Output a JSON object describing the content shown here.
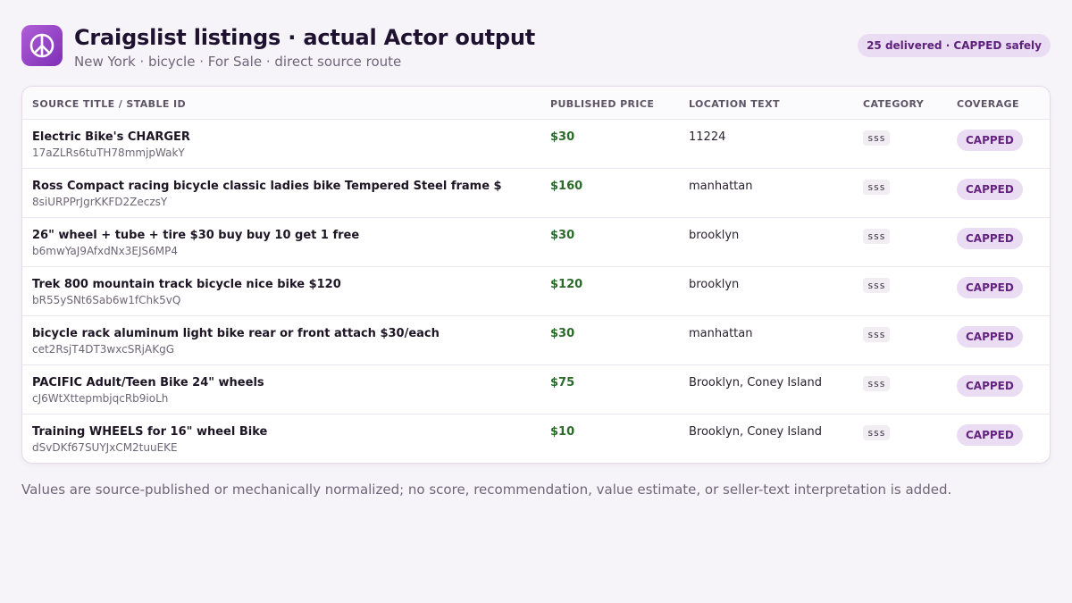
{
  "header": {
    "logo_icon": "peace-sign-icon",
    "title": "Craigslist listings · actual Actor output",
    "subtitle": "New York · bicycle · For Sale · direct source route",
    "summary_badge": "25 delivered · CAPPED safely"
  },
  "table": {
    "columns": [
      "SOURCE TITLE / STABLE ID",
      "PUBLISHED PRICE",
      "LOCATION TEXT",
      "CATEGORY",
      "COVERAGE"
    ],
    "rows": [
      {
        "title": "Electric Bike's CHARGER",
        "id": "17aZLRs6tuTH78mmjpWakY",
        "price": "$30",
        "location": "11224",
        "category": "sss",
        "coverage": "CAPPED"
      },
      {
        "title": "Ross Compact racing bicycle classic ladies bike Tempered Steel frame $",
        "id": "8siURPPrJgrKKFD2ZeczsY",
        "price": "$160",
        "location": "manhattan",
        "category": "sss",
        "coverage": "CAPPED"
      },
      {
        "title": "26\" wheel + tube + tire $30 buy buy 10 get 1 free",
        "id": "b6mwYaJ9AfxdNx3EJS6MP4",
        "price": "$30",
        "location": "brooklyn",
        "category": "sss",
        "coverage": "CAPPED"
      },
      {
        "title": "Trek 800 mountain track bicycle nice bike $120",
        "id": "bR55ySNt6Sab6w1fChk5vQ",
        "price": "$120",
        "location": "brooklyn",
        "category": "sss",
        "coverage": "CAPPED"
      },
      {
        "title": "bicycle rack aluminum light bike rear or front attach $30/each",
        "id": "cet2RsjT4DT3wxcSRjAKgG",
        "price": "$30",
        "location": "manhattan",
        "category": "sss",
        "coverage": "CAPPED"
      },
      {
        "title": "PACIFIC Adult/Teen Bike 24\" wheels",
        "id": "cJ6WtXttepmbjqcRb9ioLh",
        "price": "$75",
        "location": "Brooklyn, Coney Island",
        "category": "sss",
        "coverage": "CAPPED"
      },
      {
        "title": "Training WHEELS for 16\" wheel Bike",
        "id": "dSvDKf67SUYJxCM2tuuEKE",
        "price": "$10",
        "location": "Brooklyn, Coney Island",
        "category": "sss",
        "coverage": "CAPPED"
      }
    ]
  },
  "footnote": "Values are source-published or mechanically normalized; no score, recommendation, value estimate, or seller-text interpretation is added.",
  "colors": {
    "accent": "#8a3fc4",
    "badge_bg": "#eadcf2",
    "badge_text": "#64247f",
    "price": "#2b6a2b"
  }
}
